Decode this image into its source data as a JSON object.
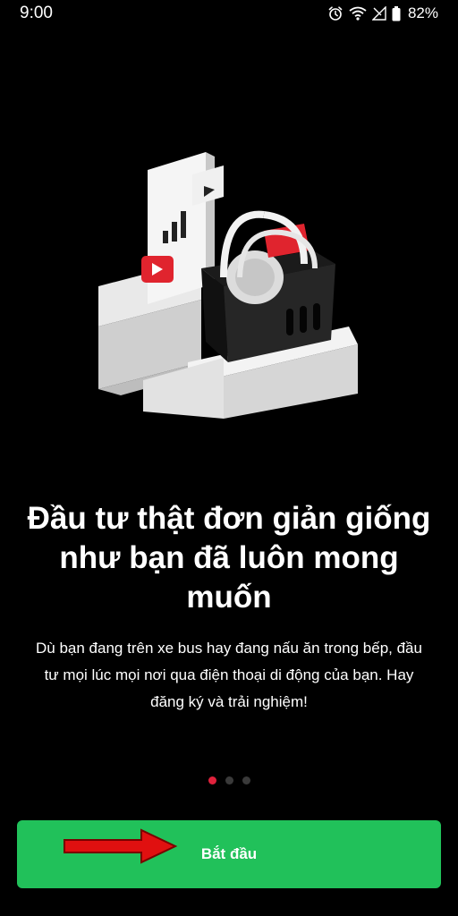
{
  "status_bar": {
    "time": "9:00",
    "battery": "82%",
    "icons": [
      "alarm-icon",
      "wifi-icon",
      "signal-icon",
      "battery-icon"
    ]
  },
  "onboarding": {
    "title": "Đầu tư thật đơn giản giống như bạn đã luôn mong muốn",
    "description": "Dù bạn đang trên xe bus hay đang nấu ăn trong bếp, đầu tư mọi lúc mọi nơi qua điện thoại di động của bạn. Hay đăng ký và trải nghiệm!",
    "page_count": 3,
    "active_page": 1
  },
  "cta": {
    "label": "Bắt đầu"
  },
  "colors": {
    "background": "#000000",
    "primary_button": "#21c15a",
    "active_dot": "#e0223c",
    "inactive_dot": "#3a3a3a",
    "annotation_arrow": "#e01010"
  }
}
